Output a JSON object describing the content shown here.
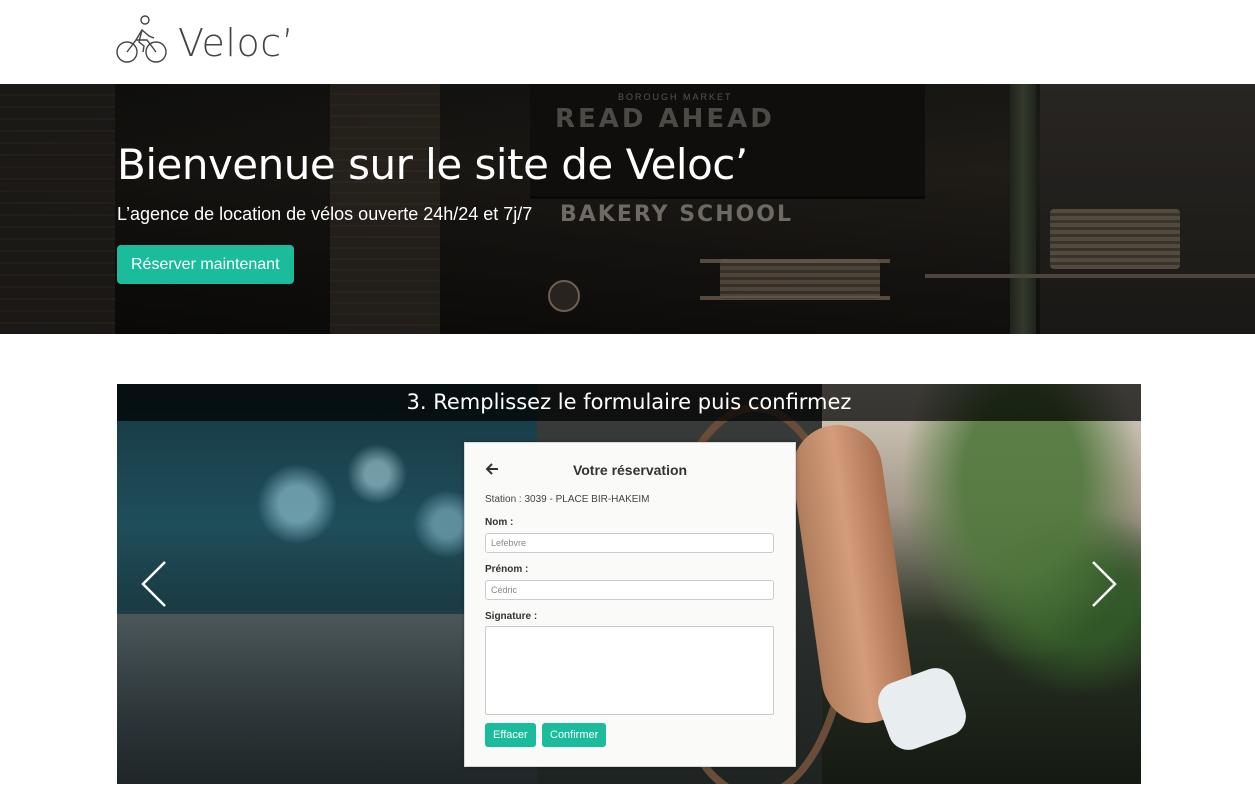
{
  "header": {
    "brand_name": "Veloc’",
    "logo_icon": "cyclist-icon"
  },
  "hero": {
    "title": "Bienvenue sur le site de Veloc’",
    "subtitle": "L’agence de location de vélos ouverte 24h/24 et 7j/7",
    "cta_label": "Réserver maintenant",
    "background_sign_text": "READ AHEAD",
    "background_sign_small": "BOROUGH        MARKET",
    "background_shop_text": "BAKERY  SCHOOL"
  },
  "carousel": {
    "caption": "3. Remplissez le formulaire puis confirmez",
    "prev_icon": "chevron-left-icon",
    "next_icon": "chevron-right-icon",
    "form": {
      "back_icon": "arrow-left-icon",
      "title": "Votre réservation",
      "station_text": "Station : 3039 - PLACE BIR-HAKEIM",
      "nom_label": "Nom :",
      "nom_value": "Lefebvre",
      "prenom_label": "Prénom :",
      "prenom_value": "Cédric",
      "signature_label": "Signature :",
      "clear_label": "Effacer",
      "confirm_label": "Confirmer"
    }
  },
  "colors": {
    "accent": "#1abc9c",
    "text_dark": "#333333"
  }
}
